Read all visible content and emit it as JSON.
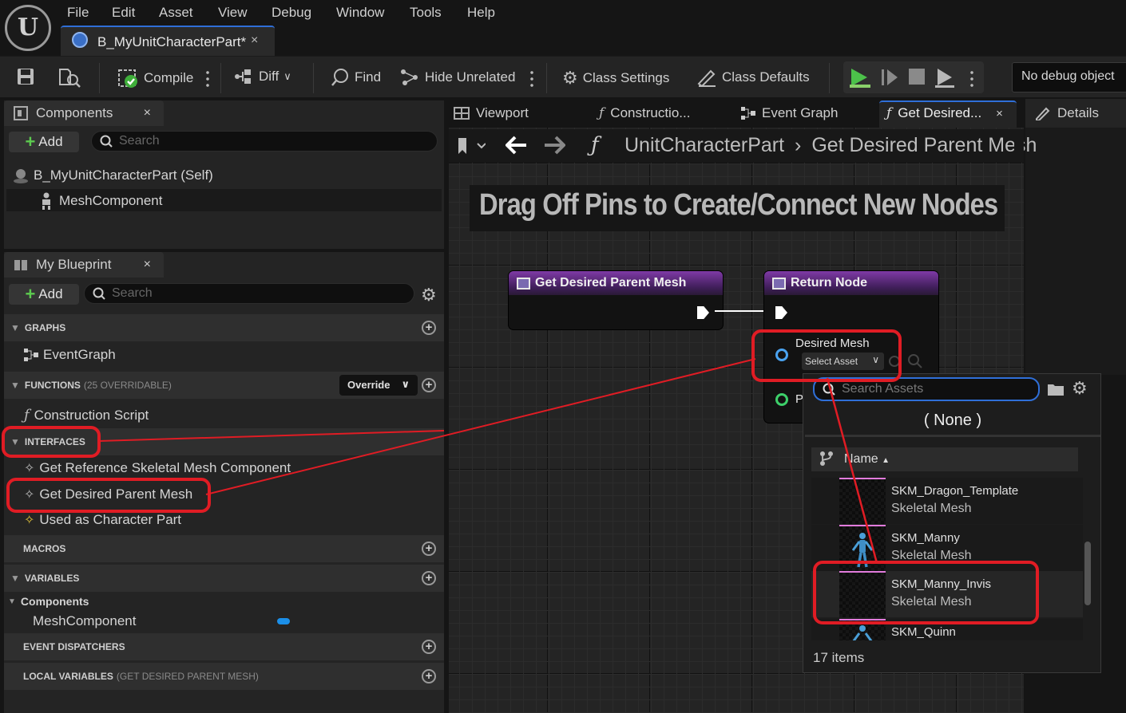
{
  "menu": {
    "logo": "U",
    "items": [
      "File",
      "Edit",
      "Asset",
      "View",
      "Debug",
      "Window",
      "Tools",
      "Help"
    ]
  },
  "document_tab": {
    "title": "B_MyUnitCharacterPart*",
    "close": "×"
  },
  "toolbar": {
    "compile": "Compile",
    "diff": "Diff",
    "find": "Find",
    "hide_unrelated": "Hide Unrelated",
    "class_settings": "Class Settings",
    "class_defaults": "Class Defaults",
    "debug_object": "No debug object"
  },
  "components_panel": {
    "tab": "Components",
    "close": "×",
    "add": "Add",
    "search_placeholder": "Search",
    "tree": [
      {
        "label": "B_MyUnitCharacterPart (Self)"
      },
      {
        "label": "MeshComponent"
      }
    ]
  },
  "myblueprint_panel": {
    "tab": "My Blueprint",
    "close": "×",
    "add": "Add",
    "search_placeholder": "Search",
    "graphs": {
      "label": "GRAPHS",
      "items": [
        "EventGraph"
      ]
    },
    "functions": {
      "label": "FUNCTIONS",
      "sub": "(25 OVERRIDABLE)",
      "override": "Override",
      "items": [
        "Construction Script"
      ]
    },
    "interfaces": {
      "label": "INTERFACES",
      "items": [
        "Get Reference Skeletal Mesh Component",
        "Get Desired Parent Mesh",
        "Used as Character Part"
      ]
    },
    "macros": {
      "label": "MACROS"
    },
    "variables": {
      "label": "VARIABLES",
      "group": "Components",
      "items": [
        "MeshComponent"
      ]
    },
    "event_dispatchers": {
      "label": "EVENT DISPATCHERS"
    },
    "local_variables": {
      "label": "LOCAL VARIABLES",
      "sub": "(GET DESIRED PARENT MESH)"
    }
  },
  "graph_tabs": {
    "viewport": "Viewport",
    "construction": "Constructio...",
    "event_graph": "Event Graph",
    "get_desired": "Get Desired...",
    "close": "×",
    "details": "Details"
  },
  "breadcrumb": {
    "parent": "UnitCharacterPart",
    "sep": "›",
    "current": "Get Desired Parent Mesh"
  },
  "graph": {
    "banner": "Drag Off Pins to Create/Connect New Nodes",
    "entry_node": {
      "title": "Get Desired Parent Mesh"
    },
    "return_node": {
      "title": "Return Node",
      "pin_label": "Desired Mesh",
      "select_asset": "Select Asset",
      "second_pin_initial": "P"
    }
  },
  "asset_picker": {
    "search_placeholder": "Search Assets",
    "none_option": "( None )",
    "column_name": "Name",
    "assets": [
      {
        "name": "SKM_Dragon_Template",
        "type": "Skeletal Mesh"
      },
      {
        "name": "SKM_Manny",
        "type": "Skeletal Mesh"
      },
      {
        "name": "SKM_Manny_Invis",
        "type": "Skeletal Mesh"
      },
      {
        "name": "SKM_Quinn",
        "type": ""
      }
    ],
    "count": "17 items"
  },
  "colors": {
    "accent_red": "#e01c24",
    "node_purple": "#7f3aa6",
    "pin_blue": "#4aa3f0",
    "pin_green": "#3dd06a"
  }
}
